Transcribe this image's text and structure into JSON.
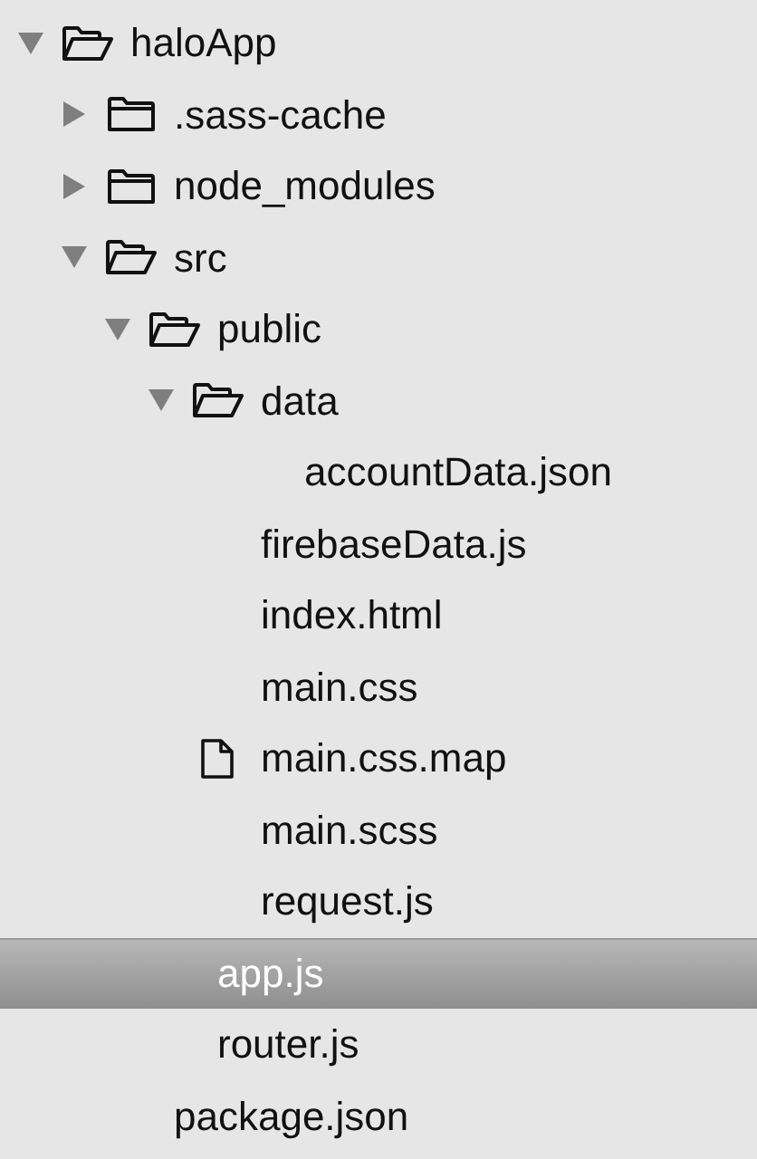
{
  "tree": [
    {
      "name": "haloApp",
      "kind": "folder",
      "expanded": true,
      "selected": false,
      "children": [
        {
          "name": ".sass-cache",
          "kind": "folder",
          "expanded": false,
          "selected": false
        },
        {
          "name": "node_modules",
          "kind": "folder",
          "expanded": false,
          "selected": false
        },
        {
          "name": "src",
          "kind": "folder",
          "expanded": true,
          "selected": false,
          "children": [
            {
              "name": "public",
              "kind": "folder",
              "expanded": true,
              "selected": false,
              "children": [
                {
                  "name": "data",
                  "kind": "folder",
                  "expanded": true,
                  "selected": false,
                  "children": [
                    {
                      "name": "accountData.json",
                      "kind": "file",
                      "selected": false
                    }
                  ]
                },
                {
                  "name": "firebaseData.js",
                  "kind": "file",
                  "selected": false
                },
                {
                  "name": "index.html",
                  "kind": "file",
                  "selected": false
                },
                {
                  "name": "main.css",
                  "kind": "file",
                  "selected": false
                },
                {
                  "name": "main.css.map",
                  "kind": "document",
                  "selected": false
                },
                {
                  "name": "main.scss",
                  "kind": "file",
                  "selected": false
                },
                {
                  "name": "request.js",
                  "kind": "file",
                  "selected": false
                }
              ]
            },
            {
              "name": "app.js",
              "kind": "file",
              "selected": true
            },
            {
              "name": "router.js",
              "kind": "file",
              "selected": false
            }
          ]
        },
        {
          "name": "package.json",
          "kind": "file",
          "selected": false
        }
      ]
    }
  ]
}
